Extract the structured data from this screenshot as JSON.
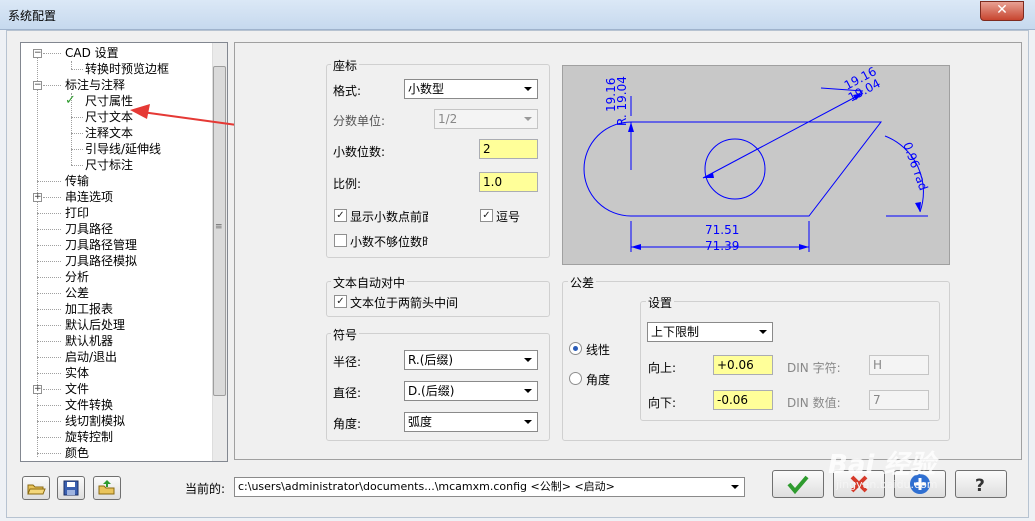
{
  "window": {
    "title": "系统配置",
    "close_label": "✕"
  },
  "tree": {
    "items": [
      {
        "label": "CAD 设置"
      },
      {
        "label": "转换时预览边框"
      },
      {
        "label": "标注与注释"
      },
      {
        "label": "尺寸属性",
        "checked": true
      },
      {
        "label": "尺寸文本"
      },
      {
        "label": "注释文本"
      },
      {
        "label": "引导线/延伸线"
      },
      {
        "label": "尺寸标注"
      },
      {
        "label": "传输"
      },
      {
        "label": "串连选项"
      },
      {
        "label": "打印"
      },
      {
        "label": "刀具路径"
      },
      {
        "label": "刀具路径管理"
      },
      {
        "label": "刀具路径模拟"
      },
      {
        "label": "分析"
      },
      {
        "label": "公差"
      },
      {
        "label": "加工报表"
      },
      {
        "label": "默认后处理"
      },
      {
        "label": "默认机器"
      },
      {
        "label": "启动/退出"
      },
      {
        "label": "实体"
      },
      {
        "label": "文件"
      },
      {
        "label": "文件转换"
      },
      {
        "label": "线切割模拟"
      },
      {
        "label": "旋转控制"
      },
      {
        "label": "颜色"
      }
    ]
  },
  "coords": {
    "group_title": "座标",
    "format_label": "格式:",
    "format_value": "小数型",
    "fraction_label": "分数单位:",
    "fraction_value": "1/2",
    "decimals_label": "小数位数:",
    "decimals_value": "2",
    "scale_label": "比例:",
    "scale_value": "1.0",
    "show_leading_zero_label": "显示小数点前面",
    "show_leading_zero": true,
    "comma_label": "逗号",
    "comma": true,
    "pad_decimals_label": "小数不够位数时",
    "pad_decimals": false
  },
  "auto_center": {
    "group_title": "文本自动对中",
    "between_arrows_label": "文本位于两箭头中间",
    "between_arrows": true
  },
  "symbols": {
    "group_title": "符号",
    "radius_label": "半径:",
    "radius_value": "R.(后缀)",
    "diameter_label": "直径:",
    "diameter_value": "D.(后缀)",
    "angle_label": "角度:",
    "angle_value": "弧度"
  },
  "tolerance": {
    "group_title": "公差",
    "linear_label": "线性",
    "angular_label": "角度",
    "selected": "linear",
    "settings_title": "设置",
    "mode_value": "上下限制",
    "upper_label": "向上:",
    "upper_value": "+0.06",
    "lower_label": "向下:",
    "lower_value": "-0.06",
    "din_char_label": "DIN 字符:",
    "din_char_value": "H",
    "din_value_label": "DIN 数值:",
    "din_value_value": "7"
  },
  "preview": {
    "dim_top1": "19.16",
    "dim_top2": "19.04",
    "dim_left1": "19.16",
    "dim_left2": "R. 19.04",
    "dim_angle": "0.96 rad",
    "dim_bottom1": "71.51",
    "dim_bottom2": "71.39"
  },
  "footer": {
    "current_label": "当前的:",
    "config_path": "c:\\users\\administrator\\documents...\\mcamxm.config <公制> <启动>"
  },
  "watermark": {
    "text": "Bai 经验",
    "sub": "jingyan.baidu.com"
  },
  "colors": {
    "highlight": "#ffff99",
    "drawing": "#0000ff",
    "arrow": "#e53935"
  }
}
